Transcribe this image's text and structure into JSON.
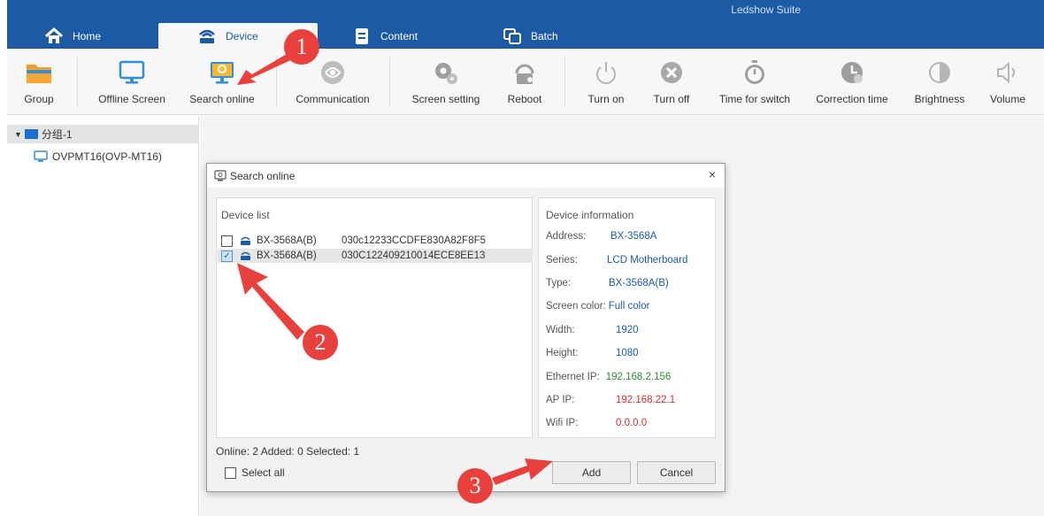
{
  "app": {
    "title": "Ledshow Suite"
  },
  "tabs": [
    {
      "label": "Home",
      "icon": "home-icon"
    },
    {
      "label": "Device",
      "icon": "device-icon"
    },
    {
      "label": "Content",
      "icon": "document-icon"
    },
    {
      "label": "Batch",
      "icon": "copy-icon"
    }
  ],
  "ribbon": {
    "items": [
      {
        "label": "Group",
        "icon": "folder-icon"
      },
      {
        "label": "Offline Screen",
        "icon": "monitor-icon"
      },
      {
        "label": "Search online",
        "icon": "search-monitor-icon"
      },
      {
        "label": "Communication",
        "icon": "communication-icon"
      },
      {
        "label": "Screen setting",
        "icon": "settings-icon"
      },
      {
        "label": "Reboot",
        "icon": "reboot-icon"
      },
      {
        "label": "Turn on",
        "icon": "power-icon"
      },
      {
        "label": "Turn off",
        "icon": "turn-off-icon"
      },
      {
        "label": "Time for switch",
        "icon": "stopwatch-icon"
      },
      {
        "label": "Correction time",
        "icon": "clock-icon"
      },
      {
        "label": "Brightness",
        "icon": "brightness-icon"
      },
      {
        "label": "Volume",
        "icon": "volume-icon"
      }
    ]
  },
  "tree": {
    "group": "分组-1",
    "device": "OVPMT16(OVP-MT16)"
  },
  "dialog": {
    "title": "Search online",
    "close": "×",
    "device_list_title": "Device list",
    "devices": [
      {
        "name": "BX-3568A(B)",
        "id": "030c12233CCDFE830A82F8F5",
        "checked": false
      },
      {
        "name": "BX-3568A(B)",
        "id": "030C122409210014ECE8EE13",
        "checked": true
      }
    ],
    "info_title": "Device information",
    "info": [
      {
        "label": "Address:",
        "value": "BX-3568A"
      },
      {
        "label": "Series:",
        "value": "LCD Motherboard"
      },
      {
        "label": "Type:",
        "value": "BX-3568A(B)"
      },
      {
        "label": "Screen color:",
        "value": "Full color"
      },
      {
        "label": "Width:",
        "value": "1920"
      },
      {
        "label": "Height:",
        "value": "1080"
      },
      {
        "label": "Ethernet IP:",
        "value": "192.168.2.156"
      },
      {
        "label": "AP IP:",
        "value": "192.168.22.1"
      },
      {
        "label": "Wifi IP:",
        "value": "0.0.0.0"
      }
    ],
    "status": "Online: 2 Added: 0 Selected: 1",
    "select_all": "Select all",
    "add": "Add",
    "cancel": "Cancel"
  },
  "annotations": {
    "one": "1",
    "two": "2",
    "three": "3",
    "color": "#e8413d"
  },
  "colors": {
    "brand": "#1c5aa6",
    "ethernet_ip": "#2e8b2e",
    "ap_ip": "#d32f2f",
    "wifi_ip": "#d32f2f"
  }
}
